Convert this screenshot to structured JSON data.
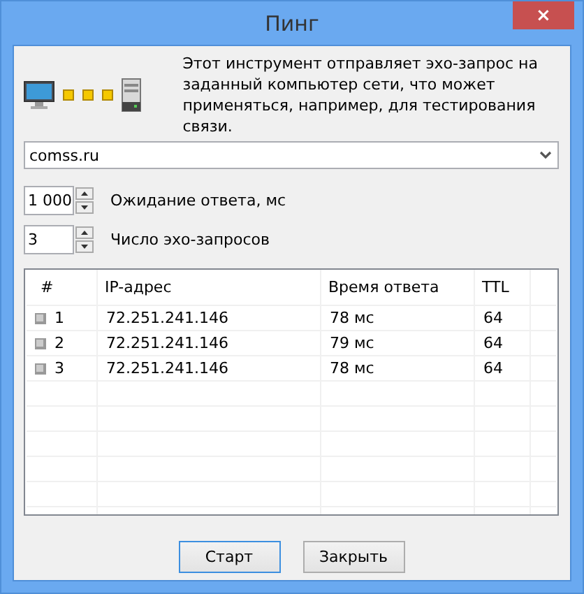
{
  "window": {
    "title": "Пинг",
    "close": "×"
  },
  "description": "Этот инструмент отправляет эхо-запрос на заданный компьютер сети, что может применяться, например, для тестирования связи.",
  "host": {
    "value": "comss.ru"
  },
  "spinners": [
    {
      "value": "1 000",
      "label": "Ожидание ответа, мс"
    },
    {
      "value": "3",
      "label": "Число эхо-запросов"
    }
  ],
  "table": {
    "columns": [
      "#",
      "IP-адрес",
      "Время ответа",
      "TTL"
    ],
    "rows": [
      {
        "n": "1",
        "ip": "72.251.241.146",
        "time": "78 мс",
        "ttl": "64"
      },
      {
        "n": "2",
        "ip": "72.251.241.146",
        "time": "79 мс",
        "ttl": "64"
      },
      {
        "n": "3",
        "ip": "72.251.241.146",
        "time": "78 мс",
        "ttl": "64"
      }
    ]
  },
  "buttons": [
    {
      "label": "Старт",
      "default": true
    },
    {
      "label": "Закрыть",
      "default": false
    }
  ]
}
